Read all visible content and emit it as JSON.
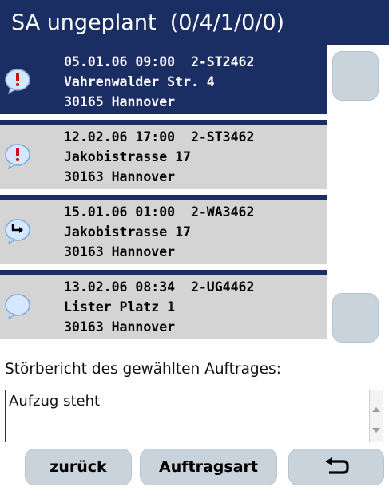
{
  "header": {
    "title": "SA ungeplant  (0/4/1/0/0)"
  },
  "orders": [
    {
      "icon": "exclamation-bubble-icon",
      "line1": "05.01.06 09:00  2-ST2462",
      "line2": "Vahrenwalder Str. 4",
      "line3": "30165 Hannover",
      "selected": true
    },
    {
      "icon": "exclamation-bubble-icon",
      "line1": "12.02.06 17:00  2-ST3462",
      "line2": "Jakobistrasse 17",
      "line3": "30163 Hannover",
      "selected": false
    },
    {
      "icon": "return-arrow-bubble-icon",
      "line1": "15.01.06 01:00  2-WA3462",
      "line2": "Jakobistrasse 17",
      "line3": "30163 Hannover",
      "selected": false
    },
    {
      "icon": "blank-bubble-icon",
      "line1": "13.02.06 08:34  2-UG4462",
      "line2": "Lister Platz 1",
      "line3": "30163 Hannover",
      "selected": false
    }
  ],
  "report": {
    "label": "Störbericht des gewählten Auftrages:",
    "text": "Aufzug steht"
  },
  "buttons": {
    "back": "zurück",
    "order_type": "Auftragsart",
    "return_icon": "return-arrow-icon"
  },
  "colors": {
    "header_bg": "#1a2e63",
    "item_bg": "#d4d4d4",
    "button_bg": "#c9d3dc"
  }
}
